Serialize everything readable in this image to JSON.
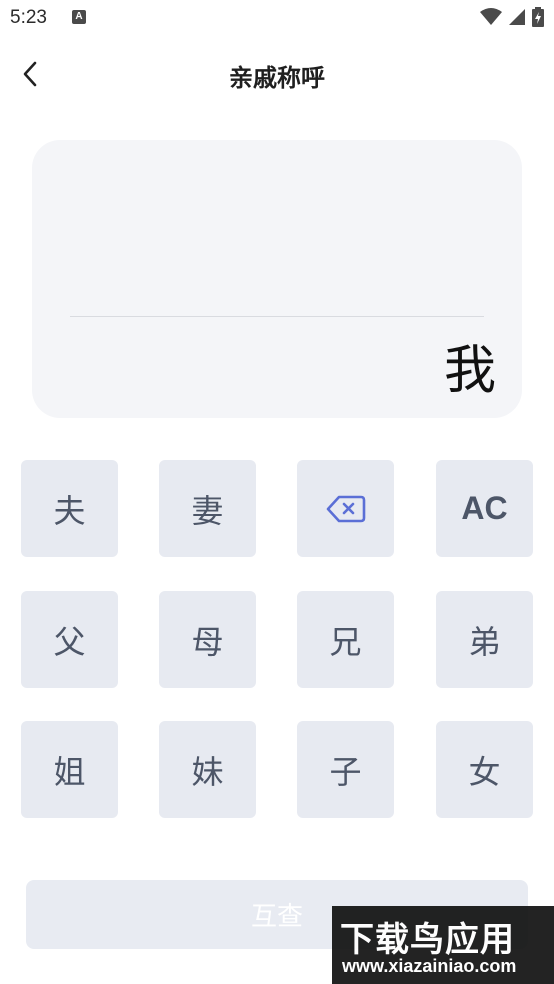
{
  "status_bar": {
    "time": "5:23",
    "notification_icon": "A"
  },
  "header": {
    "title": "亲戚称呼"
  },
  "display": {
    "result": "我"
  },
  "keypad": {
    "rows": [
      [
        "夫",
        "妻",
        "",
        "AC"
      ],
      [
        "父",
        "母",
        "兄",
        "弟"
      ],
      [
        "姐",
        "妹",
        "子",
        "女"
      ]
    ]
  },
  "actions": {
    "query_label": "互查"
  },
  "watermark": {
    "title": "下载鸟应用",
    "url": "www.xiazainiao.com"
  },
  "colors": {
    "key_bg": "#e7eaf1",
    "key_text": "#4d5668",
    "backspace_icon": "#5b6fd6",
    "card_bg": "#f4f5f8"
  }
}
